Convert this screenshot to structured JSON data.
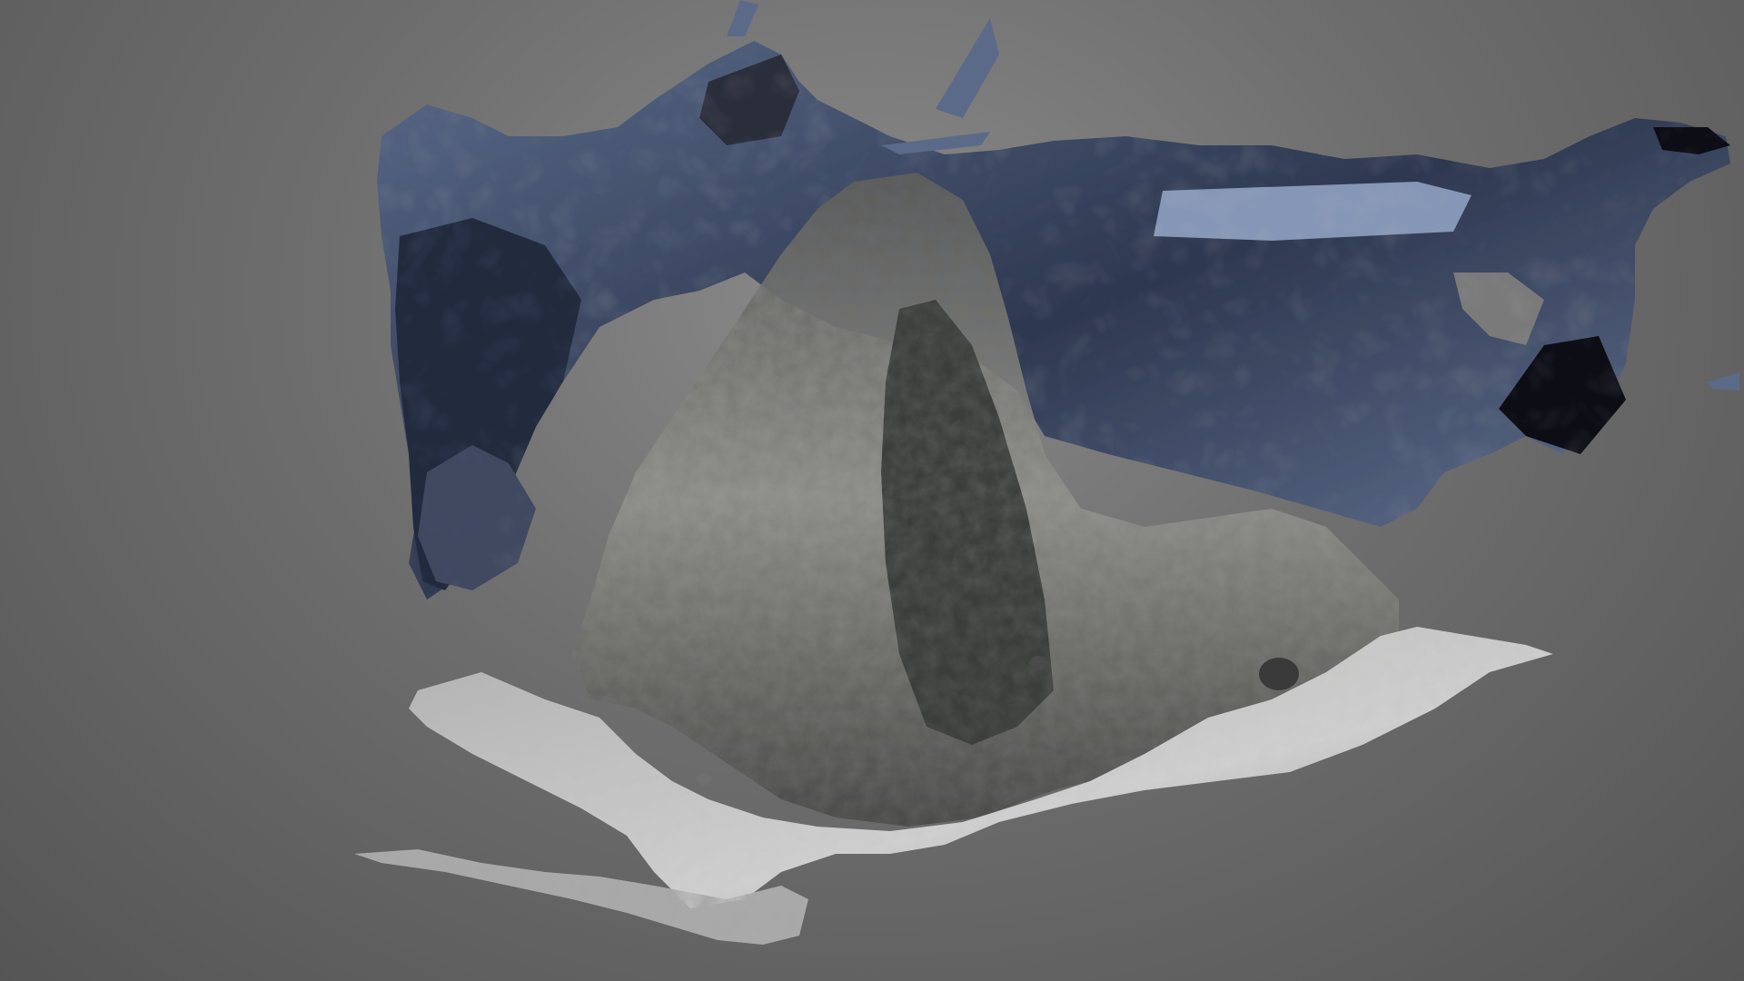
{
  "scene": {
    "model": "photogrammetry-mesh",
    "background": "gray-gradient-viewport",
    "colors": {
      "background_center": "#8a8a8a",
      "background_edge": "#555555",
      "blue_mesh_dark": "#1e2535",
      "blue_mesh_mid": "#4a5a78",
      "blue_mesh_light": "#8a9ab8",
      "rock_dark": "#3a3a38",
      "rock_mid": "#6a6a66",
      "ground_light": "#c8c8c8",
      "ground_mid": "#9a9a9a"
    }
  }
}
